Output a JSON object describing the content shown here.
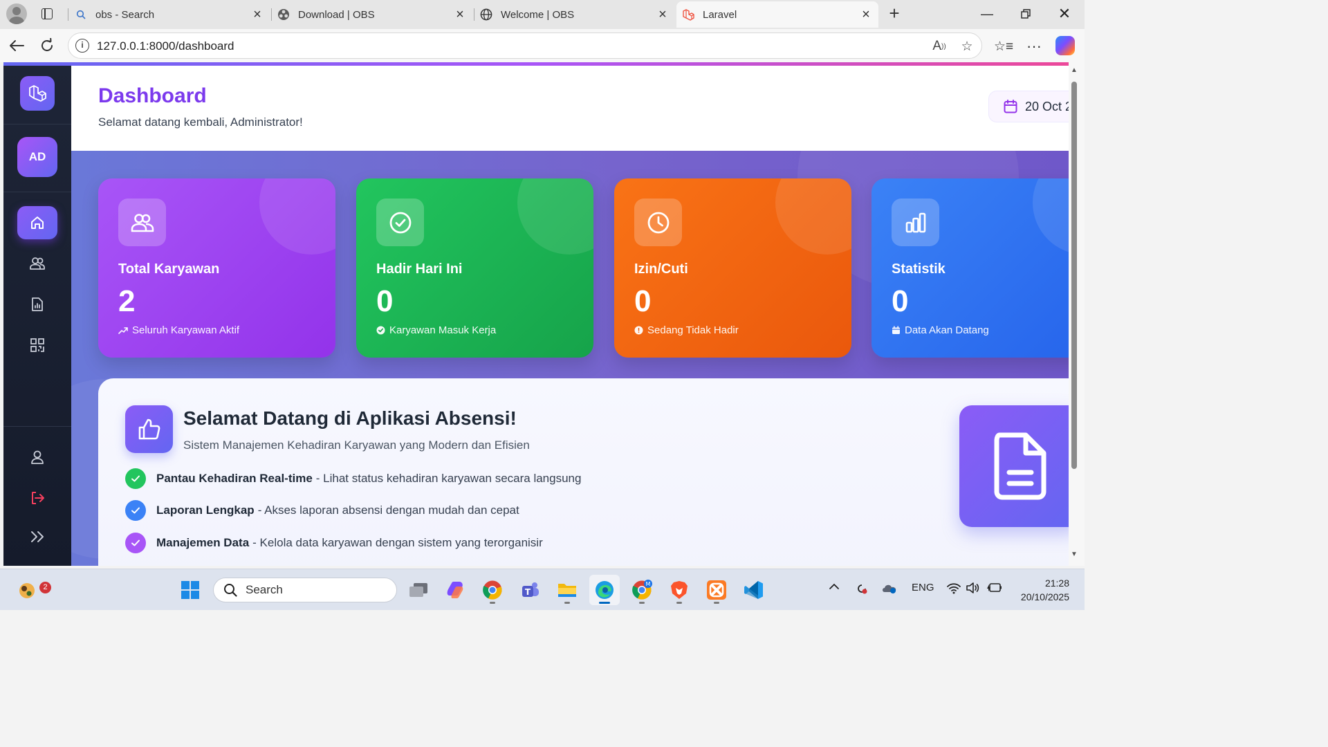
{
  "browser": {
    "tabs": [
      {
        "title": "obs - Search",
        "icon": "search-icon"
      },
      {
        "title": "Download | OBS",
        "icon": "obs-icon"
      },
      {
        "title": "Welcome | OBS",
        "icon": "globe-icon"
      },
      {
        "title": "Laravel",
        "icon": "laravel-icon",
        "active": true
      }
    ],
    "url": "127.0.0.1:8000/dashboard"
  },
  "sidebar": {
    "avatar_initials": "AD",
    "items": [
      {
        "icon": "home-icon",
        "active": true
      },
      {
        "icon": "users-icon"
      },
      {
        "icon": "report-icon"
      },
      {
        "icon": "qr-code-icon"
      }
    ],
    "bottom_items": [
      {
        "icon": "profile-icon"
      },
      {
        "icon": "logout-icon"
      },
      {
        "icon": "expand-icon"
      }
    ]
  },
  "header": {
    "title": "Dashboard",
    "subtitle": "Selamat datang kembali, Administrator!",
    "date": "20 Oct 2"
  },
  "stats": [
    {
      "label": "Total Karyawan",
      "value": "2",
      "footer": "Seluruh Karyawan Aktif",
      "icon": "users-icon",
      "color": "#9333ea"
    },
    {
      "label": "Hadir Hari Ini",
      "value": "0",
      "footer": "Karyawan Masuk Kerja",
      "icon": "check-circle-icon",
      "color": "#16a34a"
    },
    {
      "label": "Izin/Cuti",
      "value": "0",
      "footer": "Sedang Tidak Hadir",
      "icon": "clock-icon",
      "color": "#ea580c"
    },
    {
      "label": "Statistik",
      "value": "0",
      "footer": "Data Akan Datang",
      "icon": "chart-icon",
      "color": "#2563eb"
    }
  ],
  "welcome": {
    "title": "Selamat Datang di Aplikasi Absensi!",
    "subtitle": "Sistem Manajemen Kehadiran Karyawan yang Modern dan Efisien",
    "features": [
      {
        "title": "Pantau Kehadiran Real-time",
        "desc": "- Lihat status kehadiran karyawan secara langsung",
        "color": "#22c55e"
      },
      {
        "title": "Laporan Lengkap",
        "desc": "- Akses laporan absensi dengan mudah dan cepat",
        "color": "#3b82f6"
      },
      {
        "title": "Manajemen Data",
        "desc": "- Kelola data karyawan dengan sistem yang terorganisir",
        "color": "#a855f7"
      }
    ]
  },
  "taskbar": {
    "search_placeholder": "Search",
    "notification_count": "2",
    "language": "ENG",
    "time": "21:28",
    "date": "20/10/2025"
  }
}
